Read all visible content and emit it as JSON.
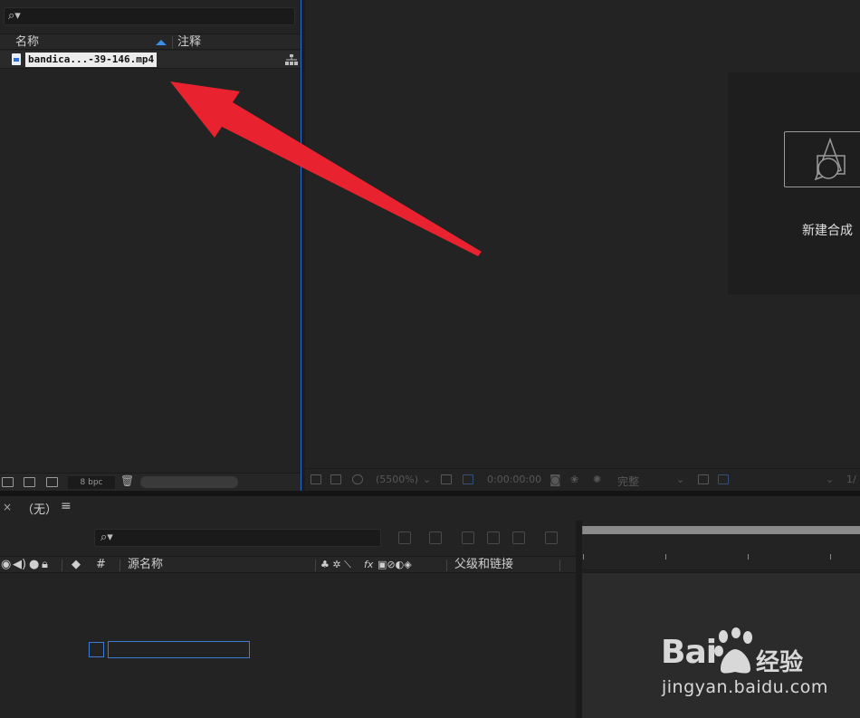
{
  "project_panel": {
    "search_placeholder": "",
    "columns": {
      "name": "名称",
      "comment": "注释"
    },
    "items": [
      {
        "name": "bandica...-39-146.mp4"
      }
    ],
    "footer": {
      "bit_depth": "8 bpc"
    }
  },
  "viewer": {
    "new_comp_label": "新建合成",
    "toolbar": {
      "zoom": "(5500%)",
      "timecode": "0:00:00:00",
      "resolution": "完整",
      "extra": "1/"
    }
  },
  "timeline": {
    "tab_close": "×",
    "tab_name": "（无）",
    "tab_menu": "≡",
    "columns": {
      "number": "#",
      "source_name": "源名称",
      "parent": "父级和链接",
      "switches": "fx"
    }
  },
  "watermark": {
    "brand": "Bai",
    "brand_suffix": "经验",
    "url": "jingyan.baidu.com"
  },
  "colors": {
    "accent": "#2d6bd0",
    "annotation_arrow": "#e8232f",
    "panel_bg": "#232323"
  },
  "icons": [
    "search-icon",
    "sort-ascending-icon",
    "mp4-file-icon",
    "flowchart-icon",
    "new-folder-icon",
    "new-composition-icon",
    "trash-icon",
    "new-comp-icon",
    "camera-icon",
    "timeline-search-icon",
    "eye-icon",
    "audio-icon",
    "solo-icon",
    "lock-icon",
    "label-icon"
  ]
}
